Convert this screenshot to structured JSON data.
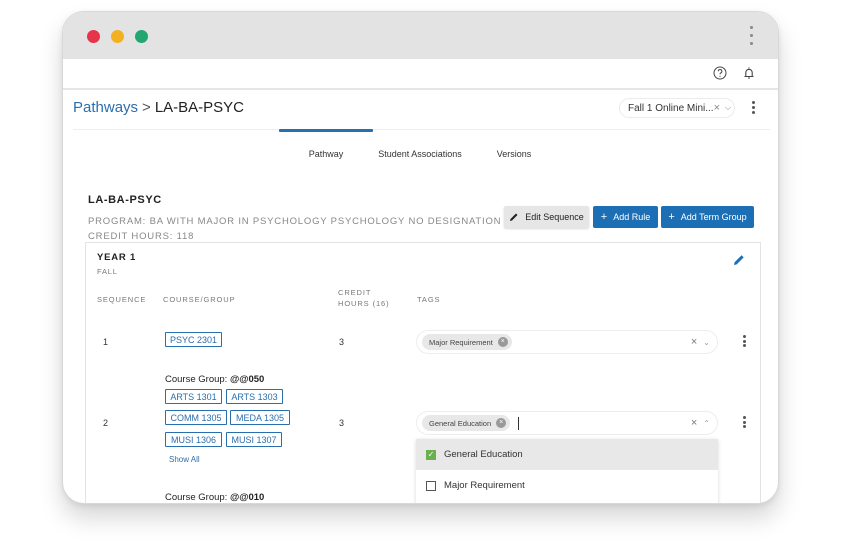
{
  "header": {
    "help_icon": "help-circle-icon",
    "bell_icon": "bell-icon"
  },
  "breadcrumb": {
    "parent": "Pathways",
    "separator": ">",
    "current": "LA-BA-PSYC"
  },
  "term_select": {
    "value": "Fall 1 Online Mini...",
    "clear": "×",
    "chevron": "⌄"
  },
  "tabs": [
    {
      "label": "Pathway",
      "active": true
    },
    {
      "label": "Student Associations",
      "active": false
    },
    {
      "label": "Versions",
      "active": false
    }
  ],
  "program": {
    "title": "LA-BA-PSYC",
    "program_line": "PROGRAM: BA WITH MAJOR IN PSYCHOLOGY PSYCHOLOGY NO DESIGNATION",
    "credit_line": "CREDIT HOURS: 118"
  },
  "actions": {
    "edit_sequence": "Edit Sequence",
    "add_rule": "Add Rule",
    "add_term_group": "Add Term Group"
  },
  "term_card": {
    "year": "YEAR 1",
    "term": "FALL",
    "columns": {
      "sequence": "SEQUENCE",
      "course": "COURSE/GROUP",
      "credit_1": "CREDIT",
      "credit_2": "HOURS (16)",
      "tags": "TAGS"
    },
    "rows": [
      {
        "sequence": "1",
        "course": "PSYC 2301",
        "credit": "3",
        "tags": [
          "Major Requirement"
        ]
      },
      {
        "sequence": "2",
        "group_prefix": "Course Group: ",
        "group_code": "@@050",
        "courses": [
          "ARTS 1301",
          "ARTS 1303",
          "COMM 1305",
          "MEDA 1305",
          "MUSI 1306",
          "MUSI 1307"
        ],
        "show_all": "Show All",
        "credit": "3",
        "tags": [
          "General Education"
        ]
      },
      {
        "group_prefix": "Course Group: ",
        "group_code": "@@010"
      }
    ],
    "tag_dropdown": [
      {
        "label": "General Education",
        "checked": true
      },
      {
        "label": "Major Requirement",
        "checked": false
      }
    ]
  }
}
